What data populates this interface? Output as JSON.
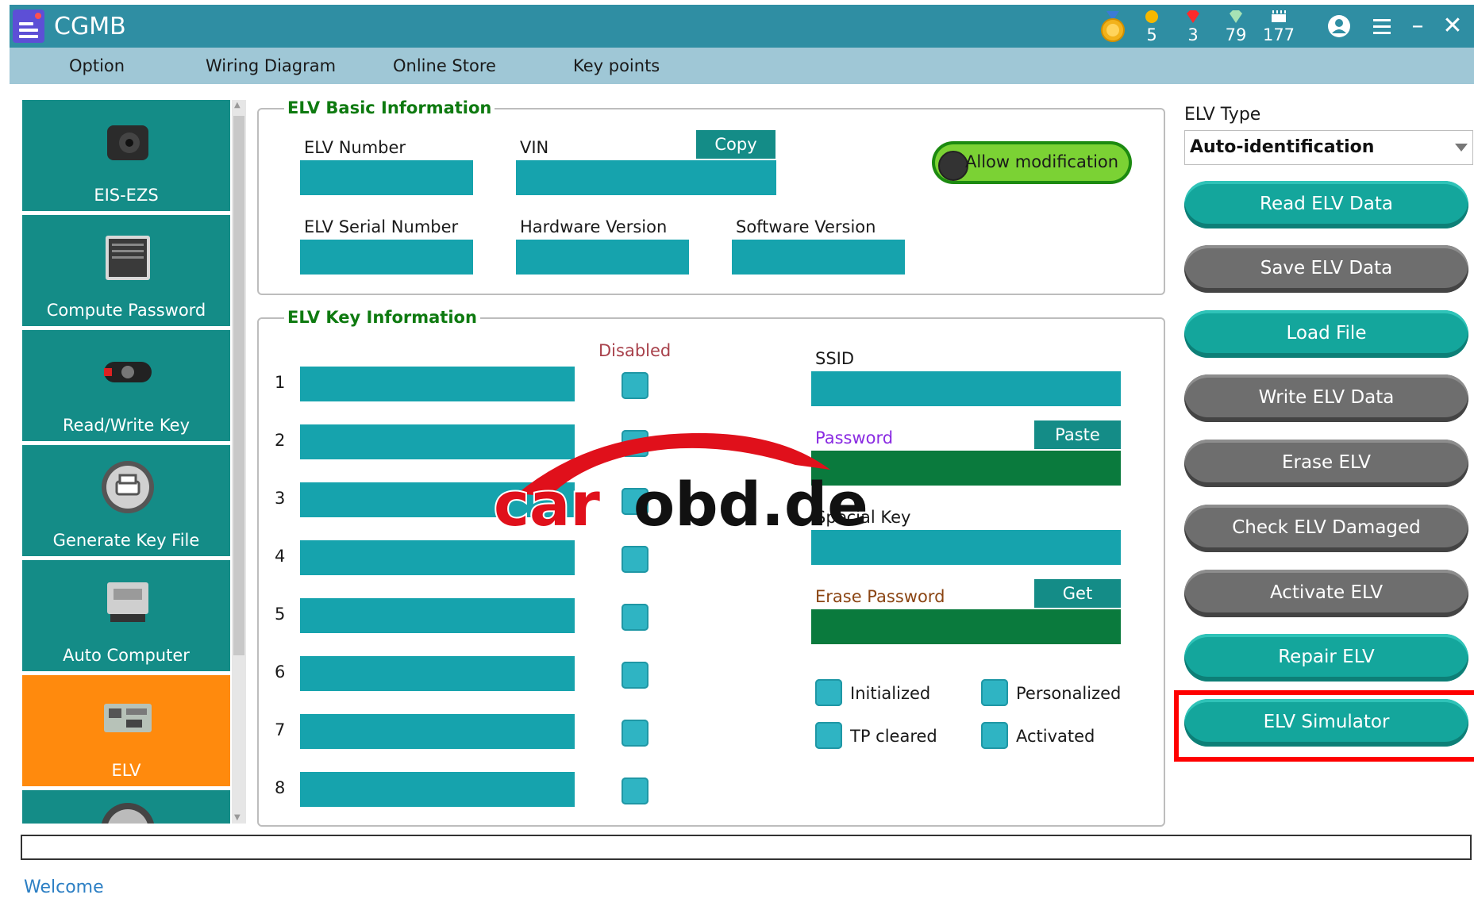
{
  "title_bar": {
    "app_name": "CGMB",
    "counters": [
      {
        "icon": "gold-coin-icon",
        "value": "5",
        "color": "#f5b800"
      },
      {
        "icon": "ruby-icon",
        "value": "3",
        "color": "#ff2a2a"
      },
      {
        "icon": "diamond-icon",
        "value": "79",
        "color": "#a7e3b5"
      },
      {
        "icon": "chip-icon",
        "value": "177",
        "color": "#ffffff"
      }
    ],
    "medal_icon": "medal-icon",
    "user_icon": "user-icon",
    "menu_icon": "hamburger-menu-icon",
    "minimize_label": "–",
    "close_label": "✕"
  },
  "menu": [
    "Option",
    "Wiring Diagram",
    "Online Store",
    "Key points"
  ],
  "sidebar": {
    "items": [
      {
        "label": "EIS-EZS",
        "icon": "eis-ignition-icon",
        "active": false
      },
      {
        "label": "Compute Password",
        "icon": "binary-chip-icon",
        "active": false
      },
      {
        "label": "Read/Write Key",
        "icon": "car-key-icon",
        "active": false
      },
      {
        "label": "Generate Key File",
        "icon": "printer-icon",
        "active": false
      },
      {
        "label": "Auto Computer",
        "icon": "ecu-module-icon",
        "active": false
      },
      {
        "label": "ELV",
        "icon": "elv-board-icon",
        "active": true
      }
    ]
  },
  "basic_info": {
    "legend": "ELV Basic Information",
    "elv_number_label": "ELV Number",
    "vin_label": "VIN",
    "copy_label": "Copy",
    "allow_label": "Allow modification",
    "serial_label": "ELV Serial Number",
    "hardware_label": "Hardware Version",
    "software_label": "Software Version"
  },
  "key_info": {
    "legend": "ELV Key Information",
    "disabled_label": "Disabled",
    "rows": [
      "1",
      "2",
      "3",
      "4",
      "5",
      "6",
      "7",
      "8"
    ],
    "ssid_label": "SSID",
    "password_label": "Password",
    "paste_label": "Paste",
    "special_key_label": "Special Key",
    "erase_password_label": "Erase Password",
    "get_label": "Get",
    "flags": {
      "initialized": "Initialized",
      "personalized": "Personalized",
      "tp_cleared": "TP cleared",
      "activated": "Activated"
    }
  },
  "right_panel": {
    "type_label": "ELV Type",
    "type_value": "Auto-identification",
    "buttons": [
      {
        "label": "Read ELV Data",
        "style": "teal"
      },
      {
        "label": "Save ELV Data",
        "style": "gray"
      },
      {
        "label": "Load File",
        "style": "teal"
      },
      {
        "label": "Write ELV Data",
        "style": "gray"
      },
      {
        "label": "Erase ELV",
        "style": "gray"
      },
      {
        "label": "Check ELV Damaged",
        "style": "gray"
      },
      {
        "label": "Activate ELV",
        "style": "gray"
      },
      {
        "label": "Repair ELV",
        "style": "teal"
      },
      {
        "label": "ELV Simulator",
        "style": "teal"
      }
    ]
  },
  "watermark": {
    "part1": "car",
    "part2": "obd.de"
  },
  "status_text": "Welcome"
}
